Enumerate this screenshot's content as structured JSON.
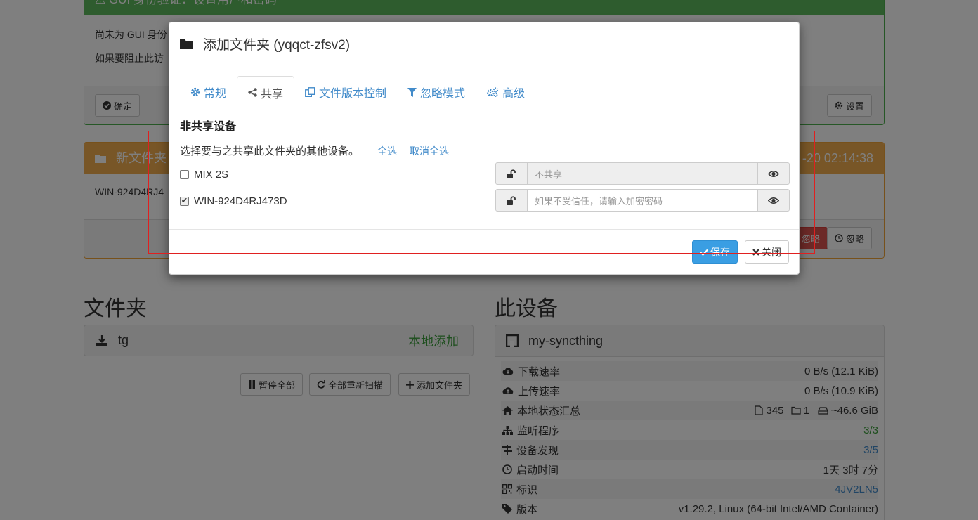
{
  "background": {
    "auth_panel": {
      "title": "⚠ GUI 身份验证：设置用户和密码",
      "line1": "尚未为 GUI 身份",
      "line2": "如果要阻止此访",
      "ok_button": "确定",
      "settings_button": "设置"
    },
    "new_folder_panel": {
      "title": "新文件夹",
      "time": "-20 02:14:38",
      "body": "WIN-924D4RJ4",
      "ignore_red_button": "忽略",
      "ignore_button": "忽略"
    },
    "folders": {
      "heading": "文件夹",
      "items": [
        {
          "name": "tg",
          "status": "本地添加"
        }
      ],
      "pause_all": "暂停全部",
      "rescan_all": "全部重新扫描",
      "add_folder": "添加文件夹"
    },
    "this_device": {
      "heading": "此设备",
      "name": "my-syncthing",
      "rows": [
        {
          "label": "下载速率",
          "value": "0 B/s (12.1 KiB)",
          "icon": "cloud-download-icon"
        },
        {
          "label": "上传速率",
          "value": "0 B/s (10.9 KiB)",
          "icon": "cloud-upload-icon"
        },
        {
          "label": "本地状态汇总",
          "files": "345",
          "dirs": "1",
          "size": "~46.6 GiB",
          "icon": "home-icon"
        },
        {
          "label": "监听程序",
          "value": "3/3",
          "icon": "sitemap-icon",
          "color": "#3c9e3c"
        },
        {
          "label": "设备发现",
          "value": "3/5",
          "icon": "signpost-icon",
          "color": "#428bca"
        },
        {
          "label": "启动时间",
          "value": "1天 3时 7分",
          "icon": "clock-icon"
        },
        {
          "label": "标识",
          "value": "4JV2LN5",
          "icon": "qrcode-icon",
          "color": "#428bca"
        },
        {
          "label": "版本",
          "value": "v1.29.2, Linux (64-bit Intel/AMD Container)",
          "icon": "tag-icon"
        }
      ]
    }
  },
  "modal": {
    "title": "添加文件夹 (yqqct-zfsv2)",
    "tabs": [
      {
        "label": "常规",
        "icon": "gear-icon"
      },
      {
        "label": "共享",
        "icon": "share-icon",
        "active": true
      },
      {
        "label": "文件版本控制",
        "icon": "copy-icon"
      },
      {
        "label": "忽略模式",
        "icon": "filter-icon"
      },
      {
        "label": "高级",
        "icon": "gears-icon"
      }
    ],
    "section_heading": "非共享设备",
    "instruction": "选择要与之共享此文件夹的其他设备。",
    "select_all": "全选",
    "deselect_all": "取消全选",
    "devices": [
      {
        "name": "MIX 2S",
        "checked": false,
        "password_placeholder": "不共享",
        "disabled": true
      },
      {
        "name": "WIN-924D4RJ473D",
        "checked": true,
        "password_placeholder": "如果不受信任，请输入加密密码",
        "disabled": false
      }
    ],
    "save_button": "保存",
    "close_button": "关闭"
  }
}
